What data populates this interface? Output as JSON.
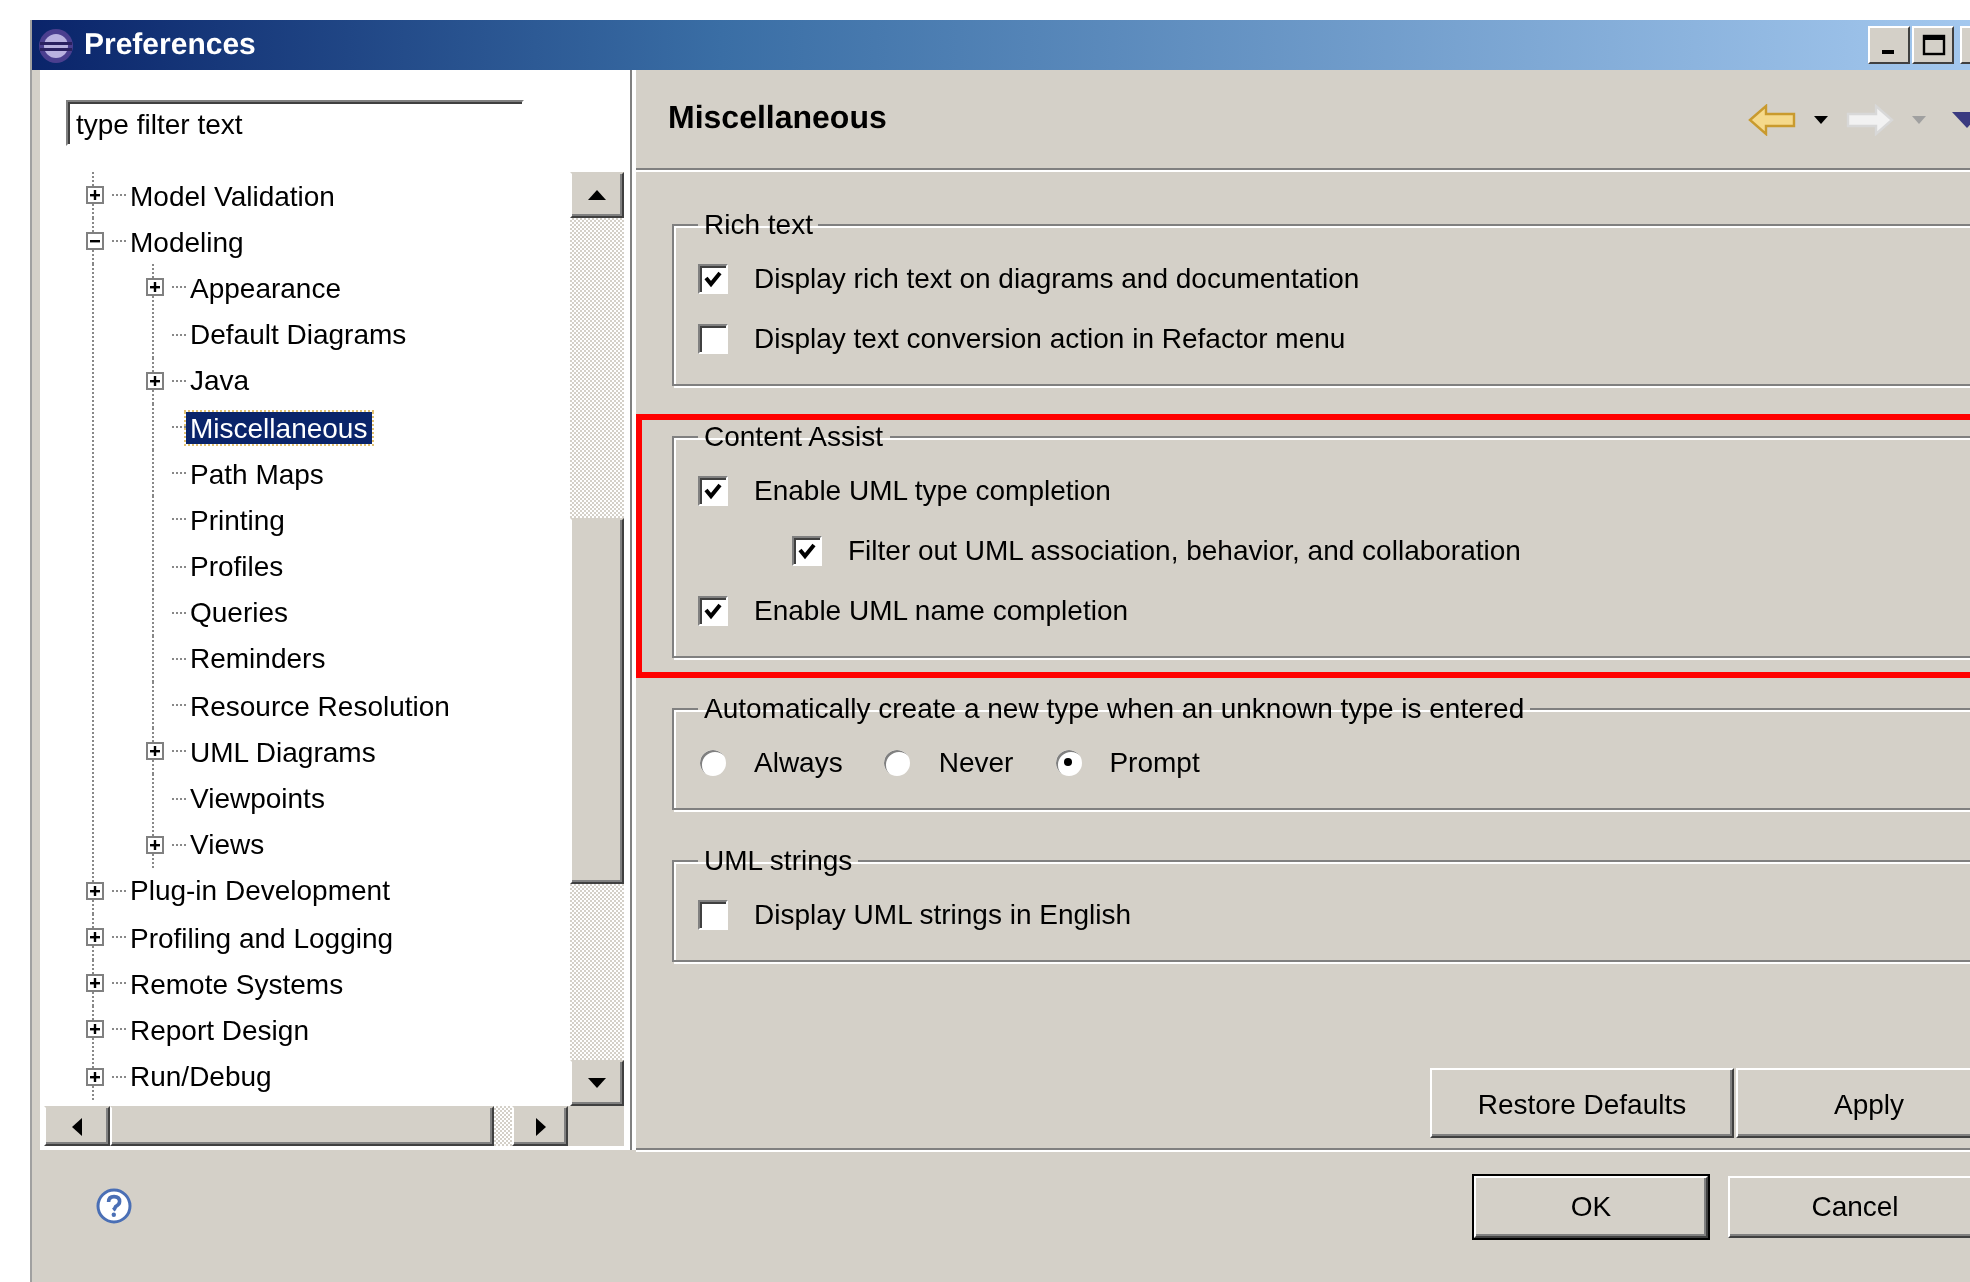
{
  "window": {
    "title": "Preferences"
  },
  "filter": {
    "value": "type filter text"
  },
  "tree": [
    {
      "label": "Model Validation",
      "kind": "folder",
      "expanded": false,
      "selected": false
    },
    {
      "label": "Modeling",
      "kind": "folder",
      "expanded": true,
      "selected": false,
      "children": [
        {
          "label": "Appearance",
          "kind": "folder",
          "expanded": false,
          "selected": false
        },
        {
          "label": "Default Diagrams",
          "kind": "leaf",
          "selected": false
        },
        {
          "label": "Java",
          "kind": "folder",
          "expanded": false,
          "selected": false
        },
        {
          "label": "Miscellaneous",
          "kind": "leaf",
          "selected": true
        },
        {
          "label": "Path Maps",
          "kind": "leaf",
          "selected": false
        },
        {
          "label": "Printing",
          "kind": "leaf",
          "selected": false
        },
        {
          "label": "Profiles",
          "kind": "leaf",
          "selected": false
        },
        {
          "label": "Queries",
          "kind": "leaf",
          "selected": false
        },
        {
          "label": "Reminders",
          "kind": "leaf",
          "selected": false
        },
        {
          "label": "Resource Resolution",
          "kind": "leaf",
          "selected": false
        },
        {
          "label": "UML Diagrams",
          "kind": "folder",
          "expanded": false,
          "selected": false
        },
        {
          "label": "Viewpoints",
          "kind": "leaf",
          "selected": false
        },
        {
          "label": "Views",
          "kind": "folder",
          "expanded": false,
          "selected": false
        }
      ]
    },
    {
      "label": "Plug-in Development",
      "kind": "folder",
      "expanded": false,
      "selected": false
    },
    {
      "label": "Profiling and Logging",
      "kind": "folder",
      "expanded": false,
      "selected": false
    },
    {
      "label": "Remote Systems",
      "kind": "folder",
      "expanded": false,
      "selected": false
    },
    {
      "label": "Report Design",
      "kind": "folder",
      "expanded": false,
      "selected": false
    },
    {
      "label": "Run/Debug",
      "kind": "folder",
      "expanded": false,
      "selected": false
    }
  ],
  "page": {
    "title": "Miscellaneous",
    "groups": [
      {
        "title": "Rich text",
        "kind": "checkboxes",
        "highlighted": false,
        "items": [
          {
            "label": "Display rich text on diagrams and documentation",
            "checked": true
          },
          {
            "label": "Display text conversion action in Refactor menu",
            "checked": false
          }
        ]
      },
      {
        "title": "Content Assist",
        "kind": "checkboxes",
        "highlighted": true,
        "items": [
          {
            "label": "Enable UML type completion",
            "checked": true,
            "children": [
              {
                "label": "Filter out UML association, behavior, and collaboration",
                "checked": true
              }
            ]
          },
          {
            "label": "Enable UML name completion",
            "checked": true
          }
        ]
      },
      {
        "title": "Automatically create a new type when an unknown type is entered",
        "kind": "radios",
        "highlighted": false,
        "items": [
          {
            "label": "Always",
            "selected": false
          },
          {
            "label": "Never",
            "selected": false
          },
          {
            "label": "Prompt",
            "selected": true
          }
        ]
      },
      {
        "title": "UML strings",
        "kind": "checkboxes",
        "highlighted": false,
        "items": [
          {
            "label": "Display UML strings in English",
            "checked": false
          }
        ]
      }
    ],
    "buttons": [
      {
        "label": "Restore Defaults",
        "default": false
      },
      {
        "label": "Apply",
        "default": false
      }
    ]
  },
  "footer": {
    "buttons": [
      {
        "label": "OK",
        "default": true
      },
      {
        "label": "Cancel",
        "default": false
      }
    ]
  }
}
